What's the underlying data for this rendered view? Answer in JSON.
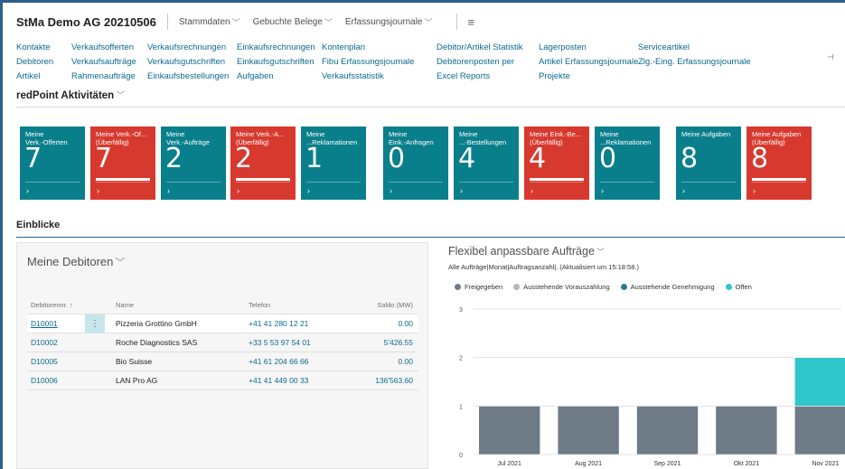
{
  "header": {
    "company": "StMa Demo AG 20210506",
    "menus": [
      "Stammdaten",
      "Gebuchte Belege",
      "Erfassungsjournale"
    ]
  },
  "nav": {
    "columns": [
      [
        "Kontakte",
        "Debitoren",
        "Artikel"
      ],
      [
        "Verkaufsofferten",
        "Verkaufsaufträge",
        "Rahmenaufträge"
      ],
      [
        "Verkaufsrechnungen",
        "Verkaufsgutschriften",
        "Einkaufsbestellungen"
      ],
      [
        "Einkaufsrechnungen",
        "Einkaufsgutschriften",
        "Aufgaben"
      ],
      [
        "Kontenplan",
        "Fibu Erfassungsjournale",
        "Verkaufsstatistik"
      ],
      [
        "Debitor/Artikel Statistik",
        "Debitorenposten per",
        "Excel Reports"
      ],
      [
        "Lagerposten",
        "Artikel Erfassungsjournale",
        "Projekte"
      ],
      [
        "Serviceartikel",
        "Zlg.-Eing. Erfassungsjournale"
      ]
    ]
  },
  "activities": {
    "title": "redPoint Aktivitäten",
    "tiles": [
      {
        "line1": "Meine",
        "line2": "Verk.-Offerten",
        "value": "7",
        "color": "teal",
        "bar": false
      },
      {
        "line1": "Meine Verk.-Of...",
        "line2": "(Überfällig)",
        "value": "7",
        "color": "red",
        "bar": true
      },
      {
        "line1": "Meine",
        "line2": "Verk.-Aufträge",
        "value": "2",
        "color": "teal",
        "bar": false
      },
      {
        "line1": "Meine Verk.-A...",
        "line2": "(Überfällig)",
        "value": "2",
        "color": "red",
        "bar": true
      },
      {
        "line1": "Meine",
        "line2": "...Reklamationen",
        "value": "1",
        "color": "teal",
        "bar": false
      },
      {
        "line1": "Meine",
        "line2": "Eink.-Anfragen",
        "value": "0",
        "color": "teal",
        "bar": false
      },
      {
        "line1": "Meine",
        "line2": "...-Bestellungen",
        "value": "4",
        "color": "teal",
        "bar": false
      },
      {
        "line1": "Meine Eink.-Be...",
        "line2": "(Überfällig)",
        "value": "4",
        "color": "red",
        "bar": true
      },
      {
        "line1": "Meine",
        "line2": "...Reklamationen",
        "value": "0",
        "color": "teal",
        "bar": false
      },
      {
        "line1": "Meine Aufgaben",
        "line2": "",
        "value": "8",
        "color": "teal",
        "bar": false
      },
      {
        "line1": "Meine Aufgaben",
        "line2": "(Überfällig)",
        "value": "8",
        "color": "red",
        "bar": true
      }
    ],
    "arrow": "›"
  },
  "einblicke": "Einblicke",
  "debitoren": {
    "title": "Meine Debitoren",
    "headers": [
      "Debitorennr. ↑",
      "Name",
      "Telefon",
      "Saldo (MW)"
    ],
    "rows": [
      [
        "D10001",
        "Pizzeria Grottino GmbH",
        "+41 41 280 12 21",
        "0.00"
      ],
      [
        "D10002",
        "Roche Diagnostics SAS",
        "+33 5 53 97 54 01",
        "5'426.55"
      ],
      [
        "D10005",
        "Bio Suisse",
        "+41 61 204 66 66",
        "0.00"
      ],
      [
        "D10006",
        "LAN Pro AG",
        "+41 41 449 00 33",
        "136'563.60"
      ]
    ]
  },
  "chart_header": {
    "title": "Flexibel anpassbare Aufträge",
    "subtitle": "Alle Aufträge|Monat|Auftragsanzahl|. (Aktualisiert um 15:18:58.)"
  },
  "chart_data": {
    "type": "bar",
    "stacked": true,
    "categories": [
      "Jul 2021",
      "Aug 2021",
      "Sep 2021",
      "Okt 2021",
      "Nov 2021"
    ],
    "series": [
      {
        "name": "Freigegeben",
        "color": "#6e7b87",
        "values": [
          1,
          1,
          1,
          1,
          1
        ]
      },
      {
        "name": "Ausstehende Vorauszahlung",
        "color": "#b4b9be",
        "values": [
          0,
          0,
          0,
          0,
          0
        ]
      },
      {
        "name": "Ausstehende Genehmigung",
        "color": "#2c7d8a",
        "values": [
          0,
          0,
          0,
          0,
          0
        ]
      },
      {
        "name": "Offen",
        "color": "#2fc6cc",
        "values": [
          0,
          0,
          0,
          0,
          1
        ]
      }
    ],
    "yticks": [
      0,
      1,
      2,
      3
    ],
    "ylim": [
      0,
      3
    ],
    "grid": true,
    "legend": "top-left"
  }
}
